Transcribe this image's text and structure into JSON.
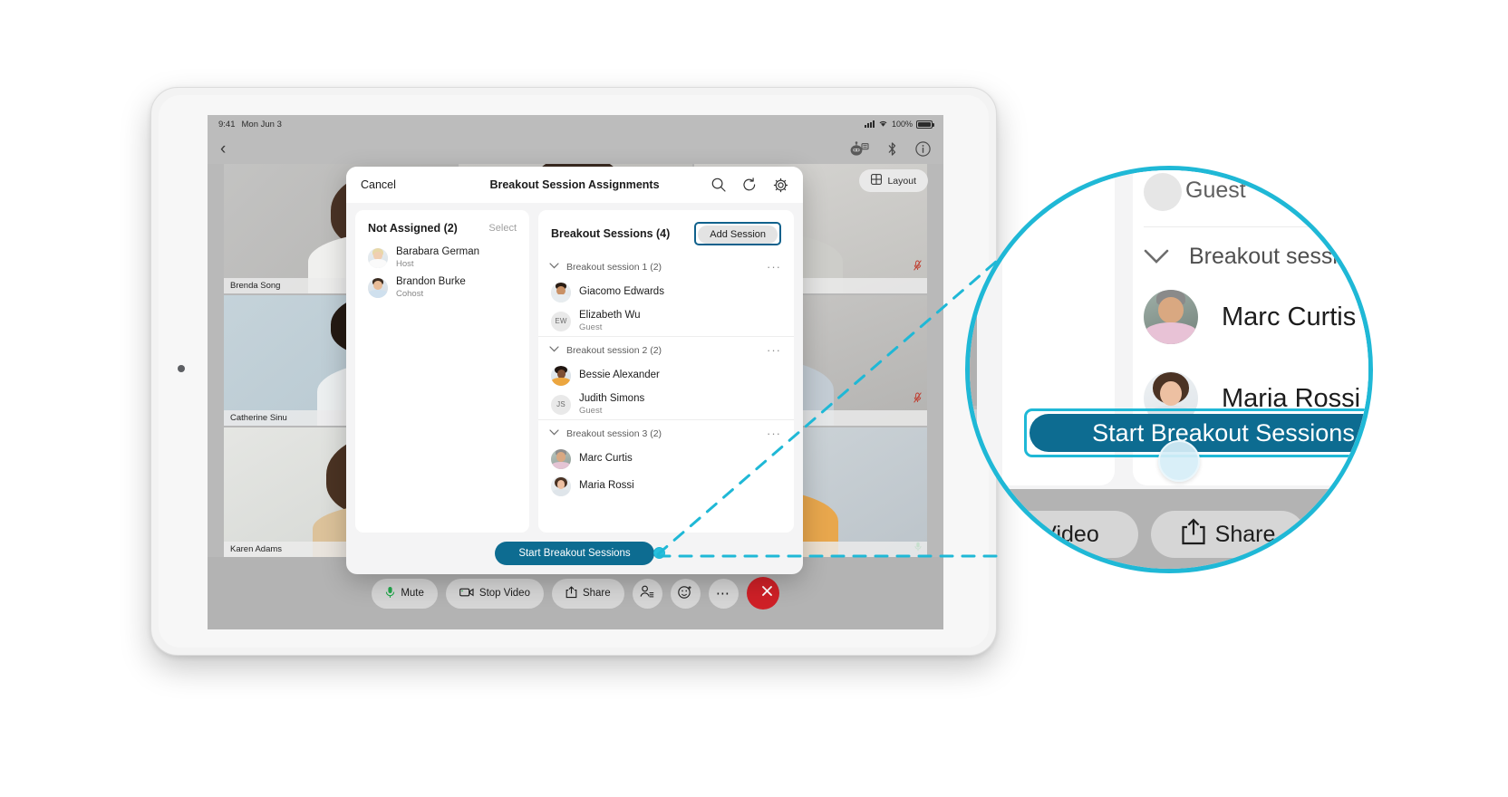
{
  "device": {
    "status_bar": {
      "time": "9:41",
      "date": "Mon Jun 3",
      "battery_percent": "100%",
      "signal_icon": "cellular-signal-icon",
      "wifi_icon": "wifi-icon",
      "battery_icon": "battery-icon"
    },
    "app_bar": {
      "back_icon": "chevron-left-icon",
      "icons": [
        "device-connect-icon",
        "bluetooth-icon",
        "info-icon"
      ]
    }
  },
  "meeting": {
    "layout_button": {
      "label": "Layout",
      "icon": "grid-layout-icon"
    },
    "tiles": [
      {
        "name": "Brenda Song",
        "muted": false,
        "mic_icon": ""
      },
      {
        "name": "",
        "muted": false,
        "mic_icon": ""
      },
      {
        "name": "",
        "muted": true,
        "mic_icon": "mic-off-icon"
      },
      {
        "name": "Catherine Sinu",
        "muted": false,
        "mic_icon": ""
      },
      {
        "name": "",
        "muted": false,
        "mic_icon": ""
      },
      {
        "name": "",
        "muted": true,
        "mic_icon": "mic-off-icon"
      },
      {
        "name": "Karen Adams",
        "muted": false,
        "mic_icon": ""
      },
      {
        "name": "",
        "muted": false,
        "mic_icon": ""
      },
      {
        "name": "",
        "muted": false,
        "mic_icon": "mic-on-icon"
      }
    ],
    "controls": [
      {
        "label": "Mute",
        "icon": "microphone-icon",
        "type": "pill"
      },
      {
        "label": "Stop Video",
        "icon": "video-camera-icon",
        "type": "pill"
      },
      {
        "label": "Share",
        "icon": "share-up-icon",
        "type": "pill"
      },
      {
        "label": "",
        "icon": "participants-icon",
        "type": "round"
      },
      {
        "label": "",
        "icon": "reactions-icon",
        "type": "round"
      },
      {
        "label": "",
        "icon": "more-icon",
        "type": "round"
      },
      {
        "label": "",
        "icon": "end-call-icon",
        "type": "end"
      }
    ]
  },
  "modal": {
    "cancel_label": "Cancel",
    "title": "Breakout Session Assignments",
    "header_icons": [
      "search-icon",
      "refresh-icon",
      "gear-icon"
    ],
    "left_panel": {
      "title": "Not Assigned (2)",
      "select_label": "Select",
      "people": [
        {
          "name": "Barabara German",
          "role": "Host",
          "initials": ""
        },
        {
          "name": "Brandon Burke",
          "role": "Cohost",
          "initials": ""
        }
      ]
    },
    "right_panel": {
      "title": "Breakout Sessions (4)",
      "add_session_label": "Add Session",
      "sessions": [
        {
          "label": "Breakout session 1 (2)",
          "chevron": "chevron-down-icon",
          "overflow": "···",
          "members": [
            {
              "name": "Giacomo Edwards",
              "role": "",
              "initials": ""
            },
            {
              "name": "Elizabeth Wu",
              "role": "Guest",
              "initials": "EW"
            }
          ]
        },
        {
          "label": "Breakout session 2 (2)",
          "chevron": "chevron-down-icon",
          "overflow": "···",
          "members": [
            {
              "name": "Bessie Alexander",
              "role": "",
              "initials": ""
            },
            {
              "name": "Judith Simons",
              "role": "Guest",
              "initials": "JS"
            }
          ]
        },
        {
          "label": "Breakout session 3 (2)",
          "chevron": "chevron-down-icon",
          "overflow": "···",
          "members": [
            {
              "name": "Marc Curtis",
              "role": "",
              "initials": ""
            },
            {
              "name": "Maria Rossi",
              "role": "",
              "initials": ""
            }
          ]
        }
      ]
    },
    "footer": {
      "start_label": "Start Breakout Sessions"
    }
  },
  "magnifier": {
    "guest_label": "Guest",
    "session_label": "Breakout session",
    "person_1": "Marc Curtis",
    "person_2": "Maria Rossi",
    "start_label": "Start Breakout Sessions",
    "controls": [
      {
        "label": "Video",
        "icon": ""
      },
      {
        "label": "Share",
        "icon": "share-up-icon"
      }
    ]
  },
  "colors": {
    "accent_teal": "#1fb8d6",
    "primary_blue": "#0d6c91",
    "focus_ring": "#10618c",
    "end_call_red": "#cf2027",
    "mic_green": "#21a84b"
  }
}
